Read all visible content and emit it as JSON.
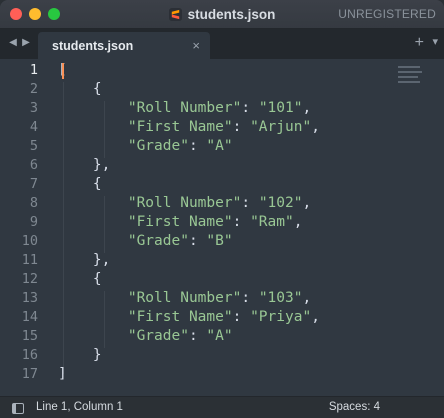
{
  "window": {
    "title": "students.json",
    "license_status": "UNREGISTERED"
  },
  "tabs": [
    {
      "label": "students.json",
      "close_icon": "×"
    }
  ],
  "tabbar": {
    "add_icon": "+",
    "menu_icon": "▾",
    "nav_left": "◀",
    "nav_right": "▶"
  },
  "editor": {
    "active_line": 1,
    "line_numbers": [
      "1",
      "2",
      "3",
      "4",
      "5",
      "6",
      "7",
      "8",
      "9",
      "10",
      "11",
      "12",
      "13",
      "14",
      "15",
      "16",
      "17"
    ],
    "lines": [
      "[",
      "    {",
      "        \"Roll Number\": \"101\",",
      "        \"First Name\": \"Arjun\",",
      "        \"Grade\": \"A\"",
      "    },",
      "    {",
      "        \"Roll Number\": \"102\",",
      "        \"First Name\": \"Ram\",",
      "        \"Grade\": \"B\"",
      "    },",
      "    {",
      "        \"Roll Number\": \"103\",",
      "        \"First Name\": \"Priya\",",
      "        \"Grade\": \"A\"",
      "    }",
      "]"
    ]
  },
  "statusbar": {
    "cursor_position": "Line 1, Column 1",
    "indentation": "Spaces: 4"
  },
  "colors": {
    "background": "#303841",
    "string": "#99c794",
    "text": "#d8dee9",
    "caret": "#f99157"
  }
}
